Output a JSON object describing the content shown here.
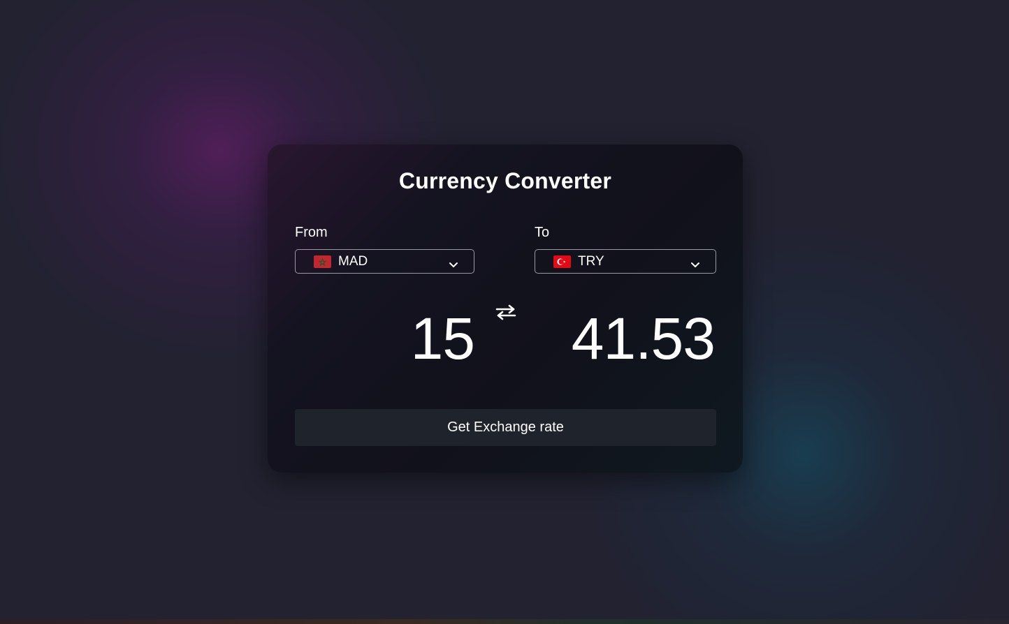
{
  "app": {
    "title": "Currency Converter"
  },
  "from": {
    "label": "From",
    "currency_code": "MAD",
    "flag_icon": "morocco-flag-icon",
    "amount": "15"
  },
  "to": {
    "label": "To",
    "currency_code": "TRY",
    "flag_icon": "turkey-flag-icon",
    "amount": "41.53"
  },
  "swap_icon": "swap-arrows-icon",
  "button": {
    "label": "Get Exchange rate"
  },
  "colors": {
    "background": "#222231",
    "card": "#11111b",
    "button": "#1f232b",
    "text": "#ffffff",
    "select_border": "#9a9aa6"
  }
}
